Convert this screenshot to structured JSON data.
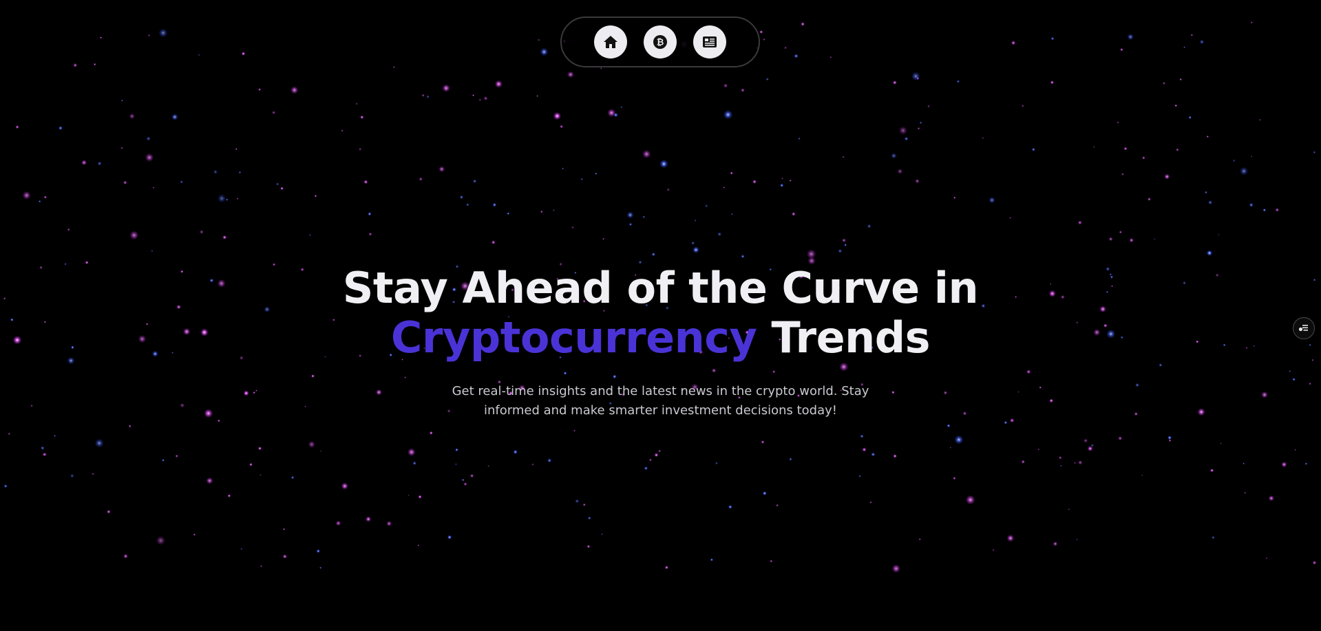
{
  "nav": {
    "items": [
      {
        "icon": "home-icon"
      },
      {
        "icon": "bitcoin-icon"
      },
      {
        "icon": "news-icon"
      }
    ]
  },
  "hero": {
    "headline_line1": "Stay Ahead of the Curve in",
    "headline_accent": "Cryptocurrency",
    "headline_rest": " Trends",
    "subtitle_line1": "Get real-time insights and the latest news in the crypto world. Stay",
    "subtitle_line2": "informed and make smarter investment decisions today!"
  },
  "side_widget": {
    "icon": "settings-sliders-icon"
  },
  "colors": {
    "background": "#000000",
    "accent": "#4a33d6",
    "headline": "#f0eff4",
    "subtitle": "#c9c9d1",
    "star_pink": "#d040e0",
    "star_blue": "#3a5cff"
  }
}
